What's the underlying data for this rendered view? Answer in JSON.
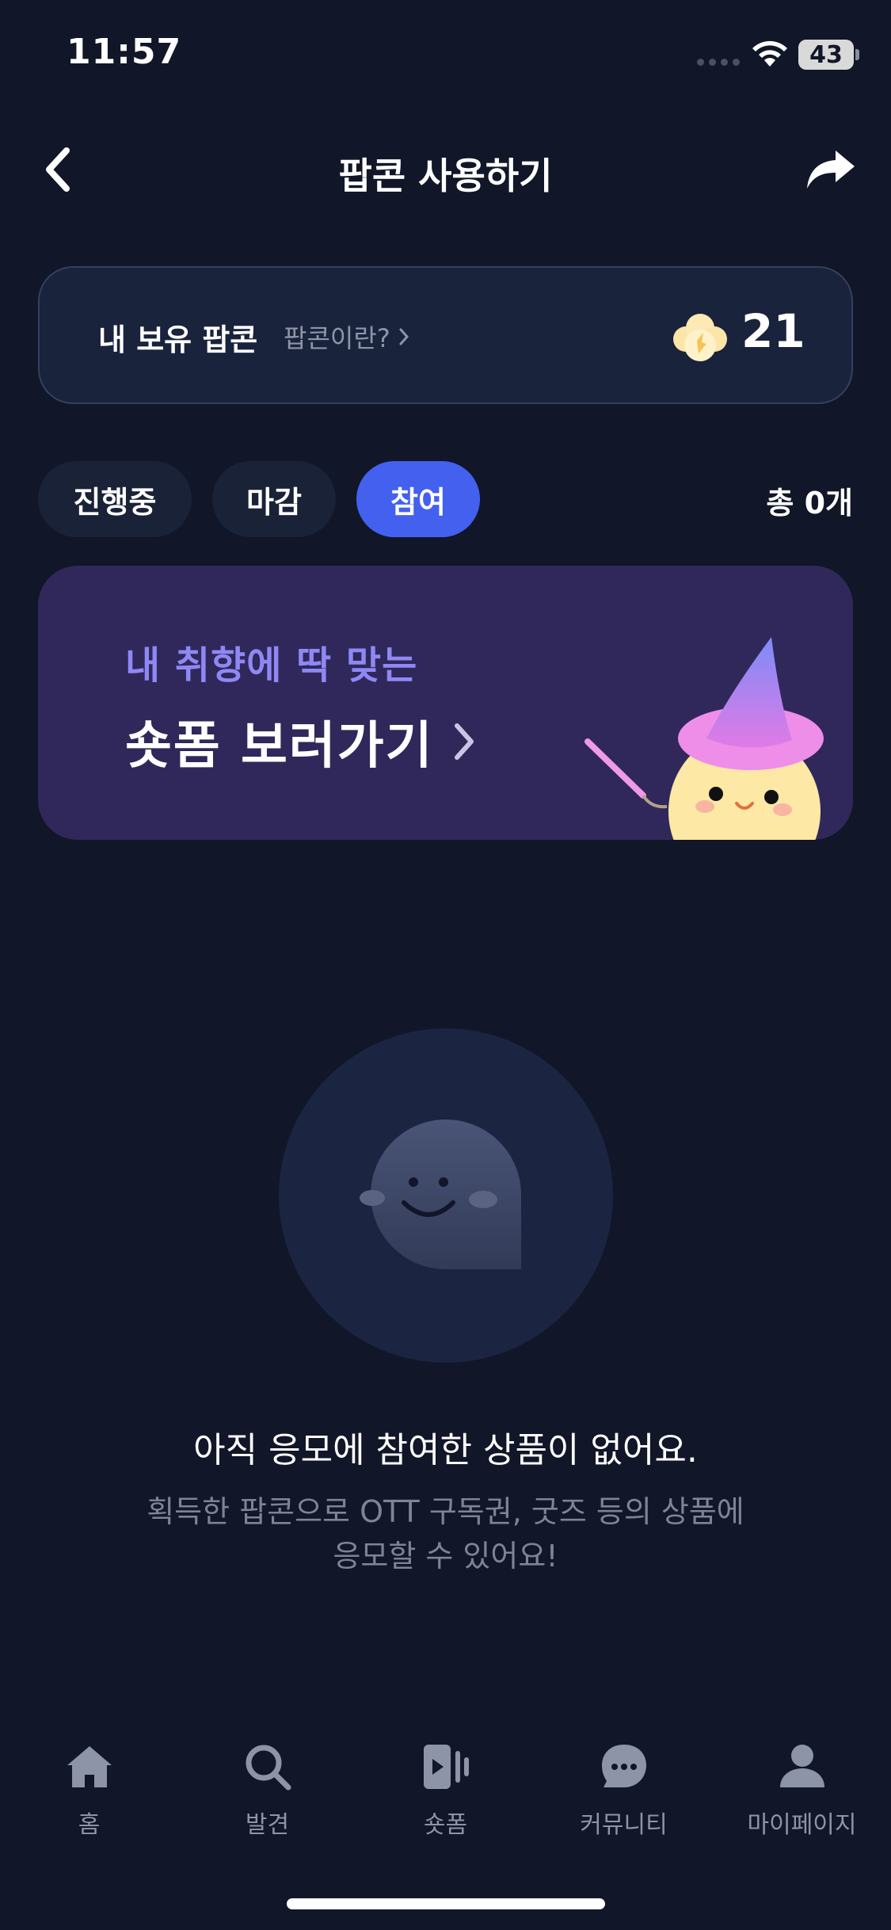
{
  "status_bar": {
    "time": "11:57",
    "battery": "43"
  },
  "header": {
    "title": "팝콘 사용하기"
  },
  "popcorn_card": {
    "label": "내 보유 팝콘",
    "help_link": "팝콘이란?",
    "count": "21"
  },
  "filters": {
    "chips": [
      {
        "label": "진행중",
        "active": false
      },
      {
        "label": "마감",
        "active": false
      },
      {
        "label": "참여",
        "active": true
      }
    ],
    "total": "총 0개"
  },
  "banner": {
    "subtitle": "내 취향에 딱 맞는",
    "title": "숏폼 보러가기"
  },
  "empty_state": {
    "title": "아직 응모에 참여한 상품이 없어요.",
    "desc_line1": "획득한 팝콘으로 OTT 구독권, 굿즈 등의 상품에",
    "desc_line2": "응모할 수 있어요!"
  },
  "tab_bar": {
    "items": [
      {
        "label": "홈",
        "icon": "home-icon"
      },
      {
        "label": "발견",
        "icon": "search-icon"
      },
      {
        "label": "숏폼",
        "icon": "shortform-icon"
      },
      {
        "label": "커뮤니티",
        "icon": "chat-bubble-icon"
      },
      {
        "label": "마이페이지",
        "icon": "person-icon"
      }
    ]
  },
  "colors": {
    "background": "#111628",
    "accent": "#4361ee",
    "card": "#1a233c",
    "banner": "#30285a",
    "banner_subtitle": "#8f88f4"
  }
}
